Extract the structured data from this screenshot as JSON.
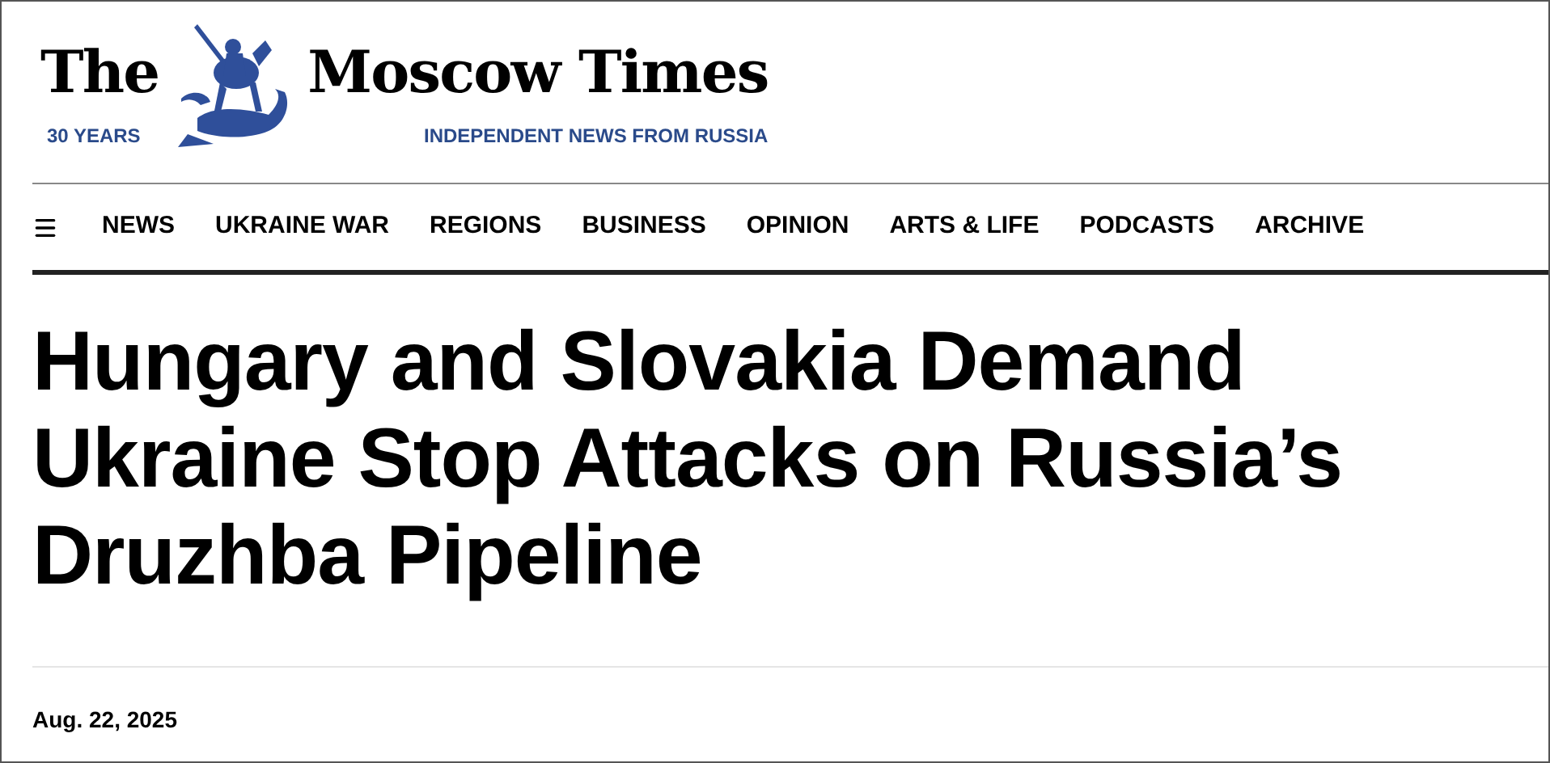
{
  "masthead": {
    "title_left": "The",
    "title_right": "Moscow Times",
    "anniversary": "30 YEARS",
    "tagline": "INDEPENDENT NEWS FROM RUSSIA"
  },
  "nav": {
    "items": [
      {
        "label": "NEWS"
      },
      {
        "label": "UKRAINE WAR"
      },
      {
        "label": "REGIONS"
      },
      {
        "label": "BUSINESS"
      },
      {
        "label": "OPINION"
      },
      {
        "label": "ARTS & LIFE"
      },
      {
        "label": "PODCASTS"
      },
      {
        "label": "ARCHIVE"
      }
    ]
  },
  "article": {
    "headline": "Hungary and Slovakia Demand Ukraine Stop Attacks on Russia’s Druzhba Pipeline",
    "date": "Aug. 22, 2025"
  }
}
